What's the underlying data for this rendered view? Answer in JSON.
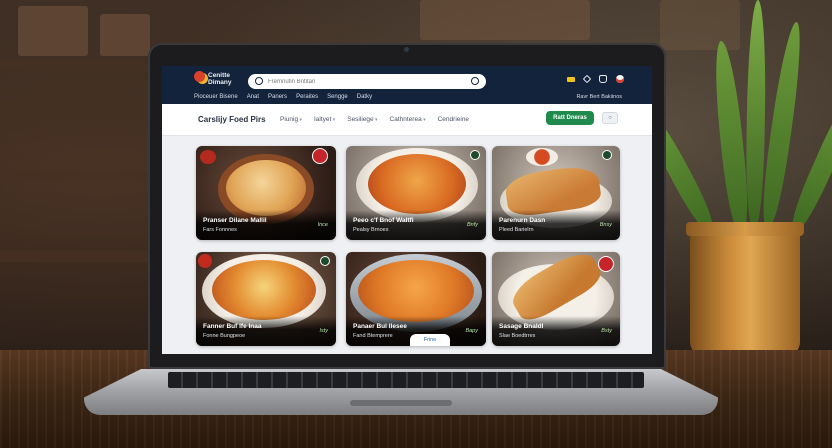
{
  "site": {
    "logo_line1": "Cenitte",
    "logo_line2": "Dimany"
  },
  "search": {
    "placeholder": "Fremnutin Bntitan"
  },
  "nav": {
    "items": [
      "Pioceuer Bisene",
      "Anat",
      "Paners",
      "Peraites",
      "Sengge",
      "Datky"
    ],
    "right_links": "Ravr Bert Bakiinos"
  },
  "subbar": {
    "title": "Carslijy Foed Pirs",
    "filters": [
      "Piunig",
      "Ialtyet",
      "Sesiliege",
      "Cathnterea",
      "Cendrieine"
    ],
    "cta_label": "Ratt Dneras",
    "mini_button": "○"
  },
  "icons": {
    "search": "search-icon",
    "flag": "flag-icon",
    "tag": "tag-icon",
    "bag": "bag-icon",
    "account": "account-icon"
  },
  "colors": {
    "header": "#14233c",
    "accent": "#1f8a4c",
    "brand_red": "#d9412a"
  },
  "cards": [
    {
      "title": "Pranser Dilane Mallil",
      "subtitle": "Fars Fonnnes",
      "rating": "Ince"
    },
    {
      "title": "Peeo c'f Bnof Waltfi",
      "subtitle": "Pealsy Brnoes",
      "rating": "Bnfy"
    },
    {
      "title": "Parenurn Dasn",
      "subtitle": "Pleed Barielrn",
      "rating": "Bnsy"
    },
    {
      "title": "Fanner Buf Ife Inaa",
      "subtitle": "Fonne Bungpeoe",
      "rating": "Isty"
    },
    {
      "title": "Panaer Bul Ilesee",
      "subtitle": "Fand Btemprere",
      "rating": "Bapy"
    },
    {
      "title": "Sasage Bnaldl",
      "subtitle": "Slae Boedtrrex",
      "rating": "Bsty"
    }
  ],
  "pill": {
    "label": "Frine"
  }
}
